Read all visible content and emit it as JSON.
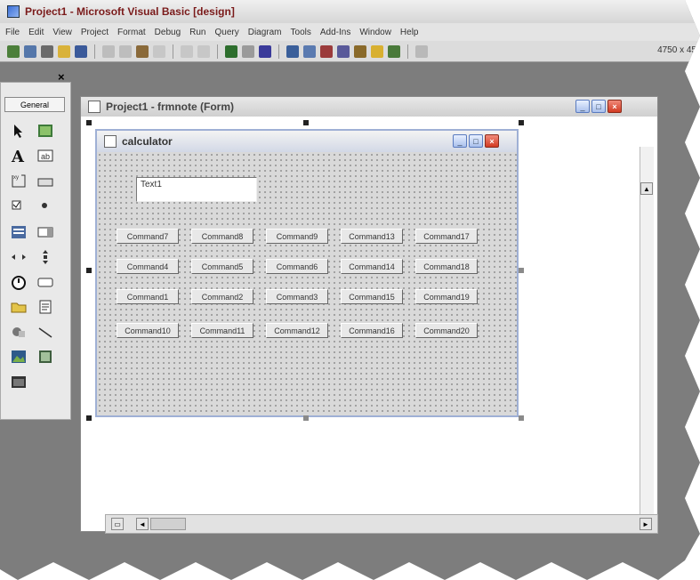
{
  "app": {
    "title": "Project1 - Microsoft Visual Basic [design]"
  },
  "menu": [
    "File",
    "Edit",
    "View",
    "Project",
    "Format",
    "Debug",
    "Run",
    "Query",
    "Diagram",
    "Tools",
    "Add-Ins",
    "Window",
    "Help"
  ],
  "toolbar": {
    "coordinates": "4750 x 45"
  },
  "toolbox": {
    "tab_label": "General",
    "close_glyph": "×"
  },
  "designer": {
    "title": "Project1 - frmnote (Form)"
  },
  "calculator": {
    "title": "calculator",
    "textbox_value": "Text1",
    "buttons": [
      [
        "Command7",
        "Command8",
        "Command9",
        "Command13",
        "Command17"
      ],
      [
        "Command4",
        "Command5",
        "Command6",
        "Command14",
        "Command18"
      ],
      [
        "Command1",
        "Command2",
        "Command3",
        "Command15",
        "Command19"
      ],
      [
        "Command10",
        "Command11",
        "Command12",
        "Command16",
        "Command20"
      ]
    ]
  },
  "window_buttons": {
    "minimize": "_",
    "maximize": "□",
    "close": "×"
  },
  "colors": {
    "title_text": "#7a1a1a",
    "close_button": "#d23a22",
    "form_border": "#9fb0d5"
  }
}
